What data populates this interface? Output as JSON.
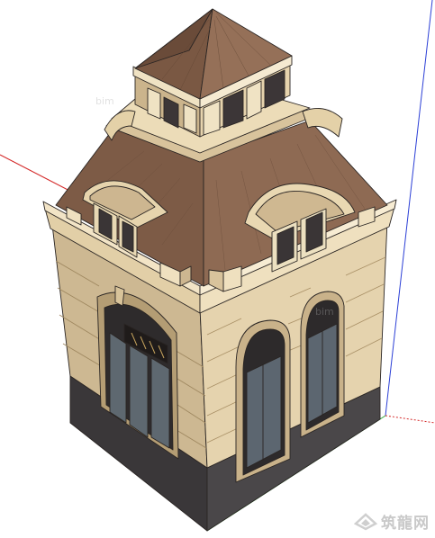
{
  "viewport": {
    "type": "3d-model-view",
    "subject": "pavilion-with-dome",
    "axis_colors": {
      "red": "#d42a2a",
      "green": "#2fa83a",
      "blue": "#2b3fd6"
    }
  },
  "colors": {
    "stone_light": "#e8d7b4",
    "stone_mid": "#d9c49c",
    "stone_shade": "#b9a278",
    "roof_brown": "#8a6650",
    "roof_dark": "#6e4f3d",
    "base_dark": "#3d3a3c",
    "glass": "#5c6670",
    "edge": "#2a2523"
  },
  "watermark": {
    "icon": "zhulong-logo-icon",
    "text": "筑龍网"
  },
  "faint_watermarks": [
    "bim",
    "bim"
  ]
}
